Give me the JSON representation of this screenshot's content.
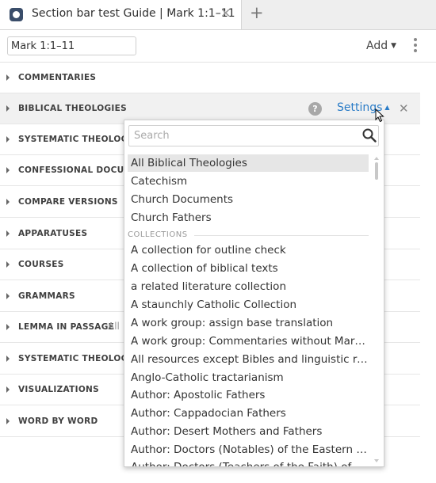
{
  "tab": {
    "title": "Section bar test Guide | Mark 1:1–11",
    "close": "✕",
    "add": "+"
  },
  "header": {
    "reference_value": "Mark 1:1–11",
    "add_label": "Add",
    "add_caret": "▼"
  },
  "sections": [
    {
      "label": "COMMENTARIES"
    },
    {
      "label": "BIBLICAL THEOLOGIES",
      "help": "?",
      "settings": "Settings",
      "settings_caret": "▲",
      "close": "✕"
    },
    {
      "label": "SYSTEMATIC THEOLOGIES"
    },
    {
      "label": "CONFESSIONAL DOCUMENTS"
    },
    {
      "label": "COMPARE VERSIONS"
    },
    {
      "label": "APPARATUSES"
    },
    {
      "label": "COURSES"
    },
    {
      "label": "GRAMMARS"
    },
    {
      "label": "LEMMA IN PASSAGE",
      "extra": "All"
    },
    {
      "label": "SYSTEMATIC THEOLOGIES"
    },
    {
      "label": "VISUALIZATIONS"
    },
    {
      "label": "WORD BY WORD"
    }
  ],
  "dropdown": {
    "search_placeholder": "Search",
    "top_items": [
      "All Biblical Theologies",
      "Catechism",
      "Church Documents",
      "Church Fathers"
    ],
    "collections_heading": "COLLECTIONS",
    "collection_items": [
      "A collection for outline check",
      "A collection of biblical texts",
      "a related literature collection",
      "A staunchly Catholic Collection",
      "A work group: assign base translation",
      "A work group: Commentaries without Mark…",
      "All resources except Bibles and linguistic res…",
      "Anglo-Catholic tractarianism",
      "Author: Apostolic Fathers",
      "Author: Cappadocian Fathers",
      "Author: Desert Mothers and Fathers",
      "Author: Doctors (Notables) of the Eastern Or…",
      "Author: Doctors (Teachers of the Faith) of the…"
    ]
  },
  "icons": {
    "tab_icon": "logos-shield-icon",
    "search_icon": "magnifier-icon",
    "kebab_icon": "vertical-ellipsis-icon"
  },
  "colors": {
    "link": "#2a7cc7",
    "tab_icon": "#3a4d6a"
  }
}
